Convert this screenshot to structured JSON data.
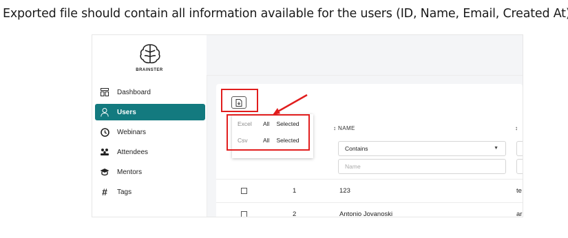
{
  "caption": "Exported file should contain all information available for the users (ID, Name, Email, Created At).",
  "brand": "BRAINSTER",
  "sidebar": {
    "items": [
      {
        "label": "Dashboard",
        "icon": "dashboard-icon"
      },
      {
        "label": "Users",
        "icon": "user-icon",
        "active": true
      },
      {
        "label": "Webinars",
        "icon": "clock-icon"
      },
      {
        "label": "Attendees",
        "icon": "people-icon"
      },
      {
        "label": "Mentors",
        "icon": "graduation-cap-icon"
      },
      {
        "label": "Tags",
        "icon": "hash-icon"
      }
    ]
  },
  "export_menu": {
    "rows": [
      {
        "format": "Excel",
        "all": "All",
        "selected": "Selected"
      },
      {
        "format": "Csv",
        "all": "All",
        "selected": "Selected"
      }
    ]
  },
  "table": {
    "headers": {
      "name": "NAME"
    },
    "filter": {
      "mode": "Contains",
      "placeholder": "Name"
    },
    "rows": [
      {
        "id": "1",
        "name": "123",
        "email_partial": "te"
      },
      {
        "id": "2",
        "name": "Antonio Jovanoski",
        "email_partial": "ar"
      }
    ]
  },
  "colors": {
    "accent": "#137a7f",
    "highlight": "#e11d1d"
  }
}
